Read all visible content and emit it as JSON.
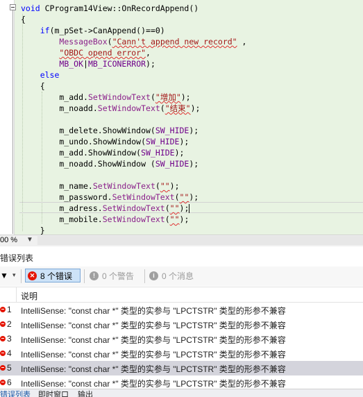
{
  "editor": {
    "lines": [
      [
        {
          "t": "void ",
          "c": "kw"
        },
        {
          "t": "CProgram14View::OnRecordAppend()",
          "c": ""
        }
      ],
      [
        {
          "t": "{",
          "c": ""
        }
      ],
      [
        {
          "t": "    ",
          "c": ""
        },
        {
          "t": "if",
          "c": "kw"
        },
        {
          "t": "(m_pSet->CanAppend()==0)",
          "c": ""
        }
      ],
      [
        {
          "t": "        ",
          "c": ""
        },
        {
          "t": "MessageBox",
          "c": "fn"
        },
        {
          "t": "(",
          "c": ""
        },
        {
          "t": "\"Cann't append new record\"",
          "c": "st sq"
        },
        {
          "t": " ,",
          "c": ""
        }
      ],
      [
        {
          "t": "        ",
          "c": ""
        },
        {
          "t": "\"OBDC opend error\"",
          "c": "st sq"
        },
        {
          "t": ",",
          "c": ""
        }
      ],
      [
        {
          "t": "        ",
          "c": ""
        },
        {
          "t": "MB_OK",
          "c": "mc"
        },
        {
          "t": "|",
          "c": ""
        },
        {
          "t": "MB_ICONERROR",
          "c": "mc"
        },
        {
          "t": ");",
          "c": ""
        }
      ],
      [
        {
          "t": "    ",
          "c": ""
        },
        {
          "t": "else",
          "c": "kw"
        }
      ],
      [
        {
          "t": "    {",
          "c": ""
        }
      ],
      [
        {
          "t": "        m_add.",
          "c": ""
        },
        {
          "t": "SetWindowText",
          "c": "fn"
        },
        {
          "t": "(",
          "c": ""
        },
        {
          "t": "\"增加\"",
          "c": "st sq"
        },
        {
          "t": ");",
          "c": ""
        }
      ],
      [
        {
          "t": "        m_noadd.",
          "c": ""
        },
        {
          "t": "SetWindowText",
          "c": "fn"
        },
        {
          "t": "(",
          "c": ""
        },
        {
          "t": "\"结束\"",
          "c": "st sq"
        },
        {
          "t": ");",
          "c": ""
        }
      ],
      [],
      [
        {
          "t": "        m_delete.ShowWindow(",
          "c": ""
        },
        {
          "t": "SW_HIDE",
          "c": "mc"
        },
        {
          "t": ");",
          "c": ""
        }
      ],
      [
        {
          "t": "        m_undo.ShowWindow(",
          "c": ""
        },
        {
          "t": "SW_HIDE",
          "c": "mc"
        },
        {
          "t": ");",
          "c": ""
        }
      ],
      [
        {
          "t": "        m_add.ShowWindow(",
          "c": ""
        },
        {
          "t": "SW_HIDE",
          "c": "mc"
        },
        {
          "t": ");",
          "c": ""
        }
      ],
      [
        {
          "t": "        m_noadd.ShowWindow (",
          "c": ""
        },
        {
          "t": "SW_HIDE",
          "c": "mc"
        },
        {
          "t": ");",
          "c": ""
        }
      ],
      [],
      [
        {
          "t": "        m_name.",
          "c": ""
        },
        {
          "t": "SetWindowText",
          "c": "fn"
        },
        {
          "t": "(",
          "c": ""
        },
        {
          "t": "\"\"",
          "c": "st sq"
        },
        {
          "t": ");",
          "c": ""
        }
      ],
      [
        {
          "t": "        m_password.",
          "c": ""
        },
        {
          "t": "SetWindowText",
          "c": "fn"
        },
        {
          "t": "(",
          "c": ""
        },
        {
          "t": "\"\"",
          "c": "st sq"
        },
        {
          "t": ");",
          "c": ""
        }
      ],
      [
        {
          "t": "        m_adress.",
          "c": ""
        },
        {
          "t": "SetWindowText",
          "c": "fn"
        },
        {
          "t": "(",
          "c": ""
        },
        {
          "t": "\"\"",
          "c": "st sq"
        },
        {
          "t": ");",
          "c": ""
        },
        {
          "t": "",
          "c": "caret"
        }
      ],
      [
        {
          "t": "        m_mobile.",
          "c": ""
        },
        {
          "t": "SetWindowText",
          "c": "fn"
        },
        {
          "t": "(",
          "c": ""
        },
        {
          "t": "\"\"",
          "c": "st sq"
        },
        {
          "t": ");",
          "c": ""
        }
      ],
      [
        {
          "t": "    }",
          "c": ""
        }
      ]
    ]
  },
  "zoom": {
    "value": "00 %"
  },
  "error_list": {
    "title": "错误列表",
    "errors_button": "8 个错误",
    "warnings_button": "0 个警告",
    "messages_button": "0 个消息",
    "column_description": "说明",
    "rows": [
      {
        "num": "1",
        "msg": "IntelliSense: \"const char *\" 类型的实参与 \"LPCTSTR\" 类型的形参不兼容"
      },
      {
        "num": "2",
        "msg": "IntelliSense: \"const char *\" 类型的实参与 \"LPCTSTR\" 类型的形参不兼容"
      },
      {
        "num": "3",
        "msg": "IntelliSense: \"const char *\" 类型的实参与 \"LPCTSTR\" 类型的形参不兼容"
      },
      {
        "num": "4",
        "msg": "IntelliSense: \"const char *\" 类型的实参与 \"LPCTSTR\" 类型的形参不兼容"
      },
      {
        "num": "5",
        "msg": "IntelliSense: \"const char *\" 类型的实参与 \"LPCTSTR\" 类型的形参不兼容"
      },
      {
        "num": "6",
        "msg": "IntelliSense: \"const char *\" 类型的实参与 \"LPCTSTR\" 类型的形参不兼容"
      }
    ],
    "selected_row": "5"
  },
  "bottom_tabs": [
    "错误列表",
    "即时窗口",
    "输出"
  ],
  "colors": {
    "keyword": "#0000ff",
    "function": "#8a1f8a",
    "string": "#a31515",
    "macro": "#6f008a",
    "error": "#e51400",
    "editor_bg": "#e8f3e2"
  },
  "icons": [
    "collapse-icon",
    "filter-icon",
    "error-icon",
    "warning-icon",
    "info-icon"
  ]
}
